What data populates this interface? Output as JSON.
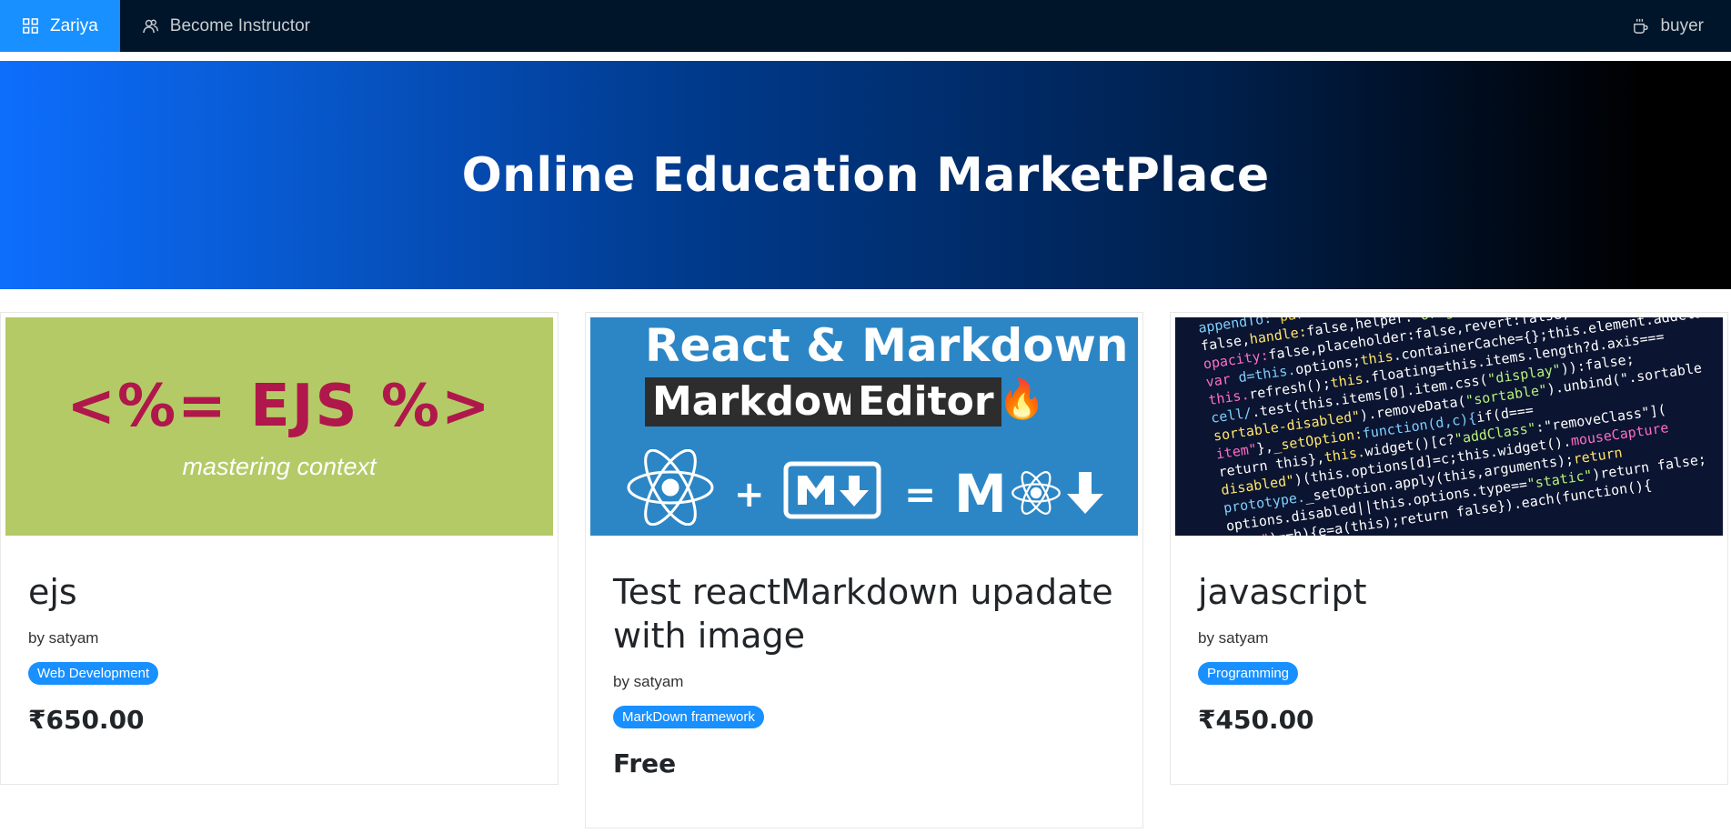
{
  "nav": {
    "brand_label": "Zariya",
    "instructor_label": "Become Instructor",
    "user_label": "buyer"
  },
  "hero": {
    "title": "Online Education MarketPlace"
  },
  "courses": [
    {
      "image": {
        "big_text": "<%= EJS %>",
        "small_text": "mastering context"
      },
      "title": "ejs",
      "author": "by satyam",
      "category": "Web Development",
      "price": "₹650.00"
    },
    {
      "image": {
        "title": "React & Markdown",
        "box1": "Markdown",
        "box2": "Editor",
        "equation": "+ M↓ = M"
      },
      "title": "Test reactMarkdown upadate with image",
      "author": "by satyam",
      "category": "MarkDown framework",
      "price": "Free"
    },
    {
      "title": "javascript",
      "author": "by satyam",
      "category": "Programming",
      "price": "₹450.00"
    }
  ],
  "colors": {
    "nav_bg": "#001529",
    "accent": "#1890ff",
    "ejs_bg": "#b4ca67",
    "ejs_text": "#b0174b",
    "react_bg": "#2c86c5"
  }
}
